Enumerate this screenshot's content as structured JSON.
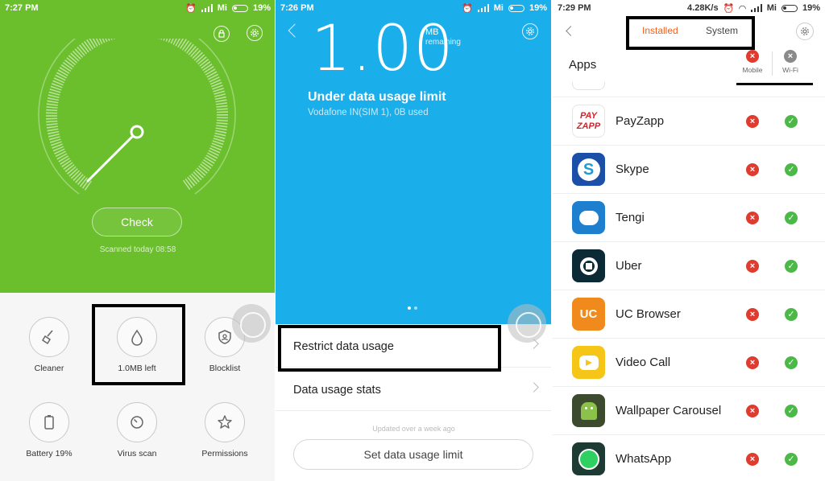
{
  "colors": {
    "security_green": "#6bbf2c",
    "data_blue": "#1aaeea",
    "tab_active": "#f0601f",
    "blocked_red": "#e03b2e",
    "allowed_green": "#4cb848"
  },
  "panel1": {
    "status": {
      "time": "7:27 PM",
      "carrier": "Mi",
      "battery": "19%"
    },
    "check_label": "Check",
    "scanned_text": "Scanned today 08:58",
    "tools": [
      {
        "label": "Cleaner",
        "icon": "broom-icon"
      },
      {
        "label": "1.0MB left",
        "icon": "data-drop-icon"
      },
      {
        "label": "Blocklist",
        "icon": "blocklist-shield-icon"
      },
      {
        "label": "Battery 19%",
        "icon": "battery-icon"
      },
      {
        "label": "Virus scan",
        "icon": "virus-scan-icon"
      },
      {
        "label": "Permissions",
        "icon": "star-icon"
      }
    ]
  },
  "panel2": {
    "status": {
      "time": "7:26 PM",
      "carrier": "Mi",
      "battery": "19%"
    },
    "remaining_value": "1.00",
    "remaining_unit": "MB",
    "remaining_label": "remaining",
    "limit_title": "Under data usage limit",
    "limit_subtitle": "Vodafone IN(SIM 1), 0B used",
    "rows": [
      {
        "label": "Restrict data usage"
      },
      {
        "label": "Data usage stats"
      }
    ],
    "updated_text": "Updated over a week ago",
    "set_limit_label": "Set data usage limit"
  },
  "panel3": {
    "status": {
      "time": "7:29 PM",
      "speed": "4.28K/s",
      "carrier": "Mi",
      "battery": "19%"
    },
    "tabs": [
      {
        "label": "Installed",
        "active": true
      },
      {
        "label": "System",
        "active": false
      }
    ],
    "apps_label": "Apps",
    "columns": [
      {
        "label": "Mobile"
      },
      {
        "label": "Wi-Fi"
      }
    ],
    "apps": [
      {
        "name": "PayZapp",
        "mobile": "blocked",
        "wifi": "allowed",
        "icon": "payzapp-icon",
        "icon_text": "PAY ZAPP",
        "icon_bg": "#ffffff"
      },
      {
        "name": "Skype",
        "mobile": "blocked",
        "wifi": "allowed",
        "icon": "skype-icon",
        "icon_text": "S",
        "icon_bg": "#1b4fa8"
      },
      {
        "name": "Tengi",
        "mobile": "blocked",
        "wifi": "allowed",
        "icon": "tengi-icon",
        "icon_text": "",
        "icon_bg": "#1e7fcf"
      },
      {
        "name": "Uber",
        "mobile": "blocked",
        "wifi": "allowed",
        "icon": "uber-icon",
        "icon_text": "",
        "icon_bg": "#0b2a36"
      },
      {
        "name": "UC Browser",
        "mobile": "blocked",
        "wifi": "allowed",
        "icon": "uc-browser-icon",
        "icon_text": "UC",
        "icon_bg": "#f08a1c"
      },
      {
        "name": "Video Call",
        "mobile": "blocked",
        "wifi": "allowed",
        "icon": "video-call-icon",
        "icon_text": "",
        "icon_bg": "#f5c518"
      },
      {
        "name": "Wallpaper Carousel",
        "mobile": "blocked",
        "wifi": "allowed",
        "icon": "wallpaper-carousel-icon",
        "icon_text": "",
        "icon_bg": "#3c4a2e"
      },
      {
        "name": "WhatsApp",
        "mobile": "blocked",
        "wifi": "allowed",
        "icon": "whatsapp-icon",
        "icon_text": "",
        "icon_bg": "#1d3a33"
      }
    ]
  }
}
